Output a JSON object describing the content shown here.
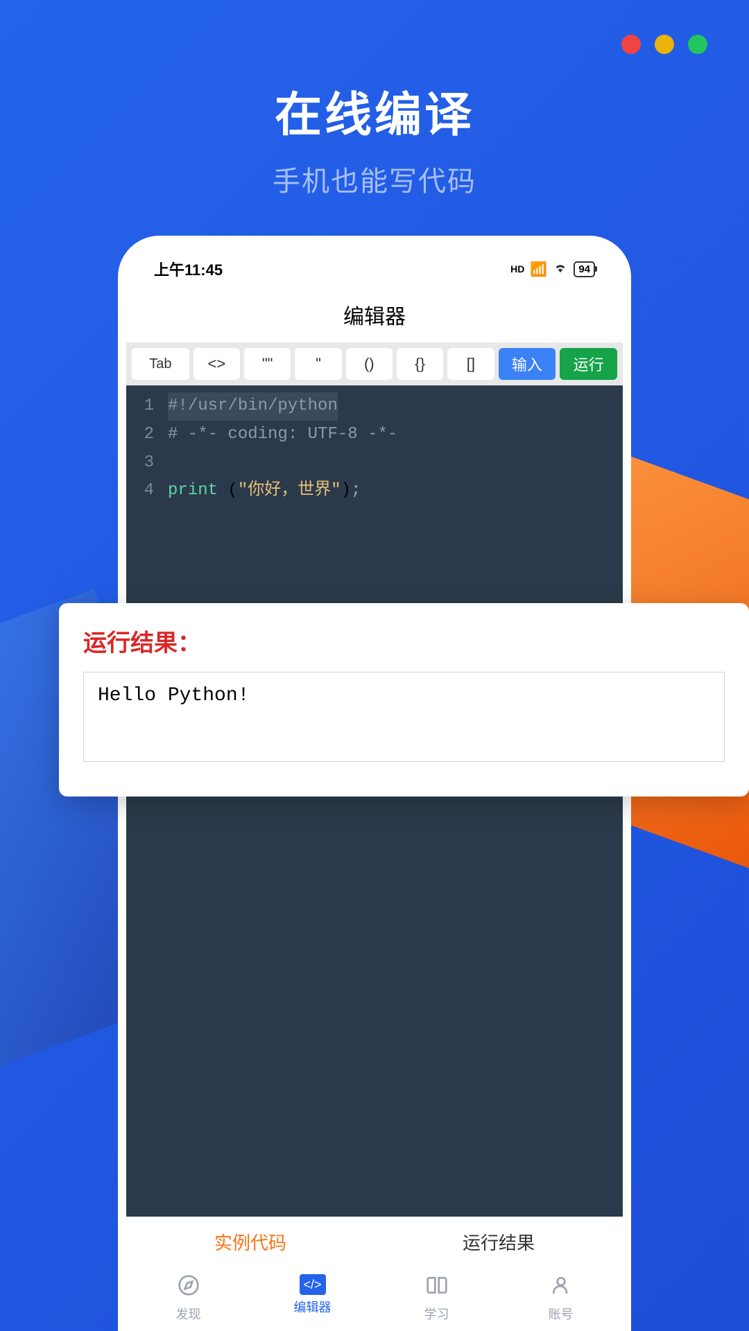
{
  "header": {
    "title": "在线编译",
    "subtitle": "手机也能写代码"
  },
  "status_bar": {
    "time": "上午11:45",
    "signal": "HD",
    "battery": "94"
  },
  "page_title": "编辑器",
  "toolbar": {
    "keys": [
      "Tab",
      "<>",
      "\"\"",
      "\"",
      "()",
      "{}",
      "[]"
    ],
    "input_btn": "输入",
    "run_btn": "运行"
  },
  "code": {
    "line1": "#!/usr/bin/python",
    "line2": "# -*- coding: UTF-8 -*-",
    "line4_keyword": "print",
    "line4_paren_open": " (",
    "line4_string": "\"你好，世界\"",
    "line4_paren_close": ")",
    "line4_semi": ";"
  },
  "gutter": [
    "1",
    "2",
    "3",
    "4"
  ],
  "tabs": {
    "example_code": "实例代码",
    "run_result": "运行结果"
  },
  "bottom_nav": {
    "discover": "发现",
    "editor": "编辑器",
    "learn": "学习",
    "account": "账号"
  },
  "result": {
    "title": "运行结果：",
    "output": "Hello Python!"
  }
}
